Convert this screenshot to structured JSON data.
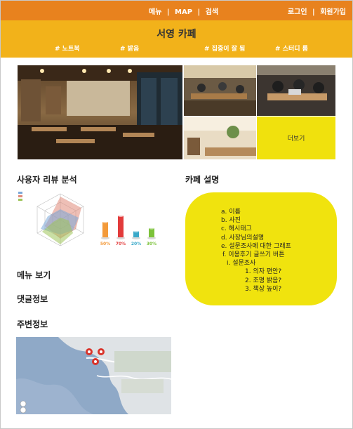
{
  "nav": {
    "menu": "메뉴",
    "map": "MAP",
    "search": "검색",
    "separator": "|",
    "login": "로그인",
    "signup": "회원가입"
  },
  "header": {
    "title": "서영 카페",
    "tags": [
      "# 노트북",
      "# 밝음",
      "# 집중이 잘 됨",
      "# 스터디 룸"
    ]
  },
  "gallery": {
    "more_label": "더보기"
  },
  "sections": {
    "review_analysis": "사용자 리뷰 분석",
    "cafe_description": "카페 설명",
    "menu": "메뉴 보기",
    "comments": "댓글정보",
    "nearby": "주변정보"
  },
  "description_items": [
    "a. 이름",
    "b. 사진",
    "c. 해시태그",
    "d. 사장님의설명",
    "e. 설문조사에 대한 그래프",
    "f. 이용후기 글쓰기 버튼",
    "i. 설문조사",
    "1. 의자 편안?",
    "2. 조명 밝음?",
    "3. 책상 높이?"
  ],
  "chart_data": {
    "type": "bar",
    "categories": [
      "",
      "",
      "",
      ""
    ],
    "values": [
      50,
      70,
      20,
      30
    ],
    "value_labels": [
      "50%",
      "70%",
      "20%",
      "30%"
    ],
    "colors": [
      "#f39a3a",
      "#e23b3b",
      "#3aa9c9",
      "#7cc23a"
    ]
  },
  "colors": {
    "topbar": "#e8821e",
    "header": "#f2b21a",
    "accent_yellow": "#f0e30e"
  }
}
